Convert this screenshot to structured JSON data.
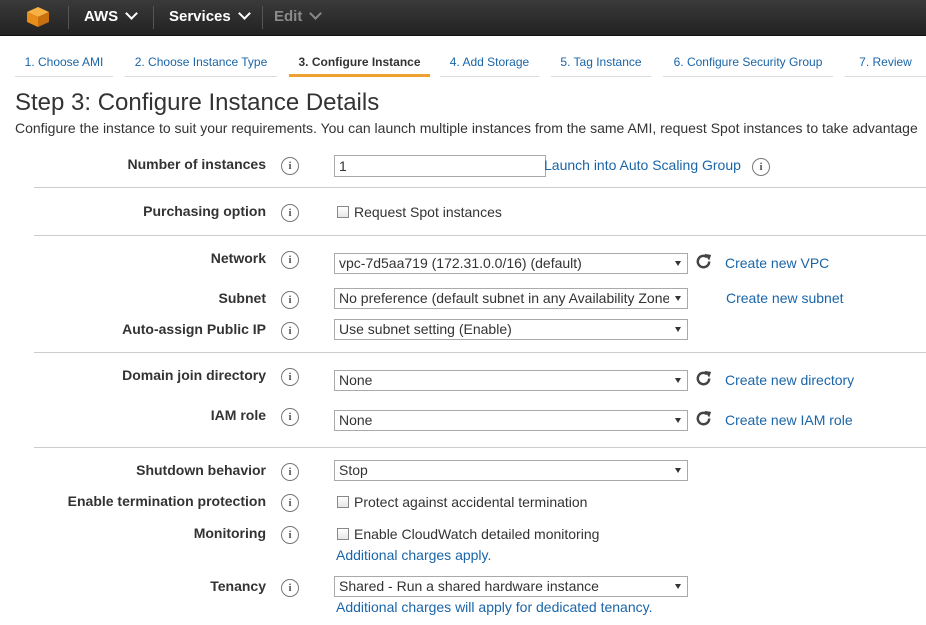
{
  "topnav": {
    "brand": "AWS",
    "services": "Services",
    "edit": "Edit"
  },
  "wizard": {
    "tabs": [
      "1. Choose AMI",
      "2. Choose Instance Type",
      "3. Configure Instance",
      "4. Add Storage",
      "5. Tag Instance",
      "6. Configure Security Group",
      "7. Review"
    ],
    "active_index": 2
  },
  "page": {
    "title": "Step 3: Configure Instance Details",
    "description": "Configure the instance to suit your requirements. You can launch multiple instances from the same AMI, request Spot instances to take advantage"
  },
  "form": {
    "number_of_instances": {
      "label": "Number of instances",
      "value": "1",
      "link": "Launch into Auto Scaling Group"
    },
    "purchasing_option": {
      "label": "Purchasing option",
      "checkbox_label": "Request Spot instances"
    },
    "network": {
      "label": "Network",
      "value": "vpc-7d5aa719 (172.31.0.0/16) (default)",
      "link": "Create new VPC"
    },
    "subnet": {
      "label": "Subnet",
      "value": "No preference (default subnet in any Availability Zone)",
      "link": "Create new subnet"
    },
    "auto_assign_ip": {
      "label": "Auto-assign Public IP",
      "value": "Use subnet setting (Enable)"
    },
    "domain_join": {
      "label": "Domain join directory",
      "value": "None",
      "link": "Create new directory"
    },
    "iam_role": {
      "label": "IAM role",
      "value": "None",
      "link": "Create new IAM role"
    },
    "shutdown_behavior": {
      "label": "Shutdown behavior",
      "value": "Stop"
    },
    "termination_protection": {
      "label": "Enable termination protection",
      "checkbox_label": "Protect against accidental termination"
    },
    "monitoring": {
      "label": "Monitoring",
      "checkbox_label": "Enable CloudWatch detailed monitoring",
      "note": "Additional charges apply."
    },
    "tenancy": {
      "label": "Tenancy",
      "value": "Shared - Run a shared hardware instance",
      "note": "Additional charges will apply for dedicated tenancy."
    }
  },
  "icons": {
    "info": "i",
    "logo": "aws-cube-logo",
    "refresh": "refresh-icon"
  },
  "colors": {
    "nav_bg": "#2b2b2b",
    "link": "#1a65a8",
    "active_tab_underline": "#f0a030",
    "logo": "#f0a030"
  }
}
